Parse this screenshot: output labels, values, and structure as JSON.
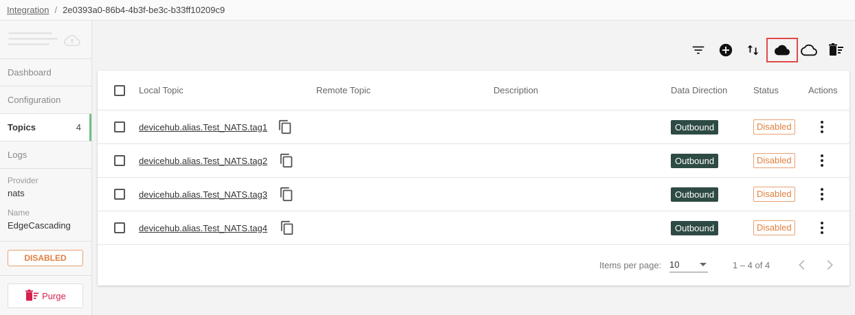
{
  "breadcrumb": {
    "link": "Integration",
    "separator": "/",
    "current": "2e0393a0-86b4-4b3f-be3c-b33ff10209c9"
  },
  "sidebar": {
    "nav": [
      {
        "label": "Dashboard"
      },
      {
        "label": "Configuration"
      },
      {
        "label": "Topics",
        "count": "4"
      },
      {
        "label": "Logs"
      }
    ],
    "provider_label": "Provider",
    "provider_value": "nats",
    "name_label": "Name",
    "name_value": "EdgeCascading",
    "status": "DISABLED",
    "purge_label": "Purge"
  },
  "toolbar": {
    "icons": [
      "filter-icon",
      "add-circle-icon",
      "swap-vertical-icon",
      "cloud-filled-icon",
      "cloud-outline-icon",
      "delete-sweep-icon"
    ],
    "highlighted": "cloud-filled-icon"
  },
  "table": {
    "headers": {
      "local_topic": "Local Topic",
      "remote_topic": "Remote Topic",
      "description": "Description",
      "direction": "Data Direction",
      "status": "Status",
      "actions": "Actions"
    },
    "rows": [
      {
        "local_topic": "devicehub.alias.Test_NATS.tag1",
        "remote_topic": "",
        "description": "",
        "direction": "Outbound",
        "status": "Disabled"
      },
      {
        "local_topic": "devicehub.alias.Test_NATS.tag2",
        "remote_topic": "",
        "description": "",
        "direction": "Outbound",
        "status": "Disabled"
      },
      {
        "local_topic": "devicehub.alias.Test_NATS.tag3",
        "remote_topic": "",
        "description": "",
        "direction": "Outbound",
        "status": "Disabled"
      },
      {
        "local_topic": "devicehub.alias.Test_NATS.tag4",
        "remote_topic": "",
        "description": "",
        "direction": "Outbound",
        "status": "Disabled"
      }
    ]
  },
  "paginator": {
    "items_label": "Items per page:",
    "page_size": "10",
    "range": "1 – 4 of 4"
  },
  "colors": {
    "accent": "#6fbf8a",
    "outbound": "#2e4a44",
    "disabled": "#e07f3e",
    "purge": "#d6204f",
    "highlight": "#e04848"
  }
}
